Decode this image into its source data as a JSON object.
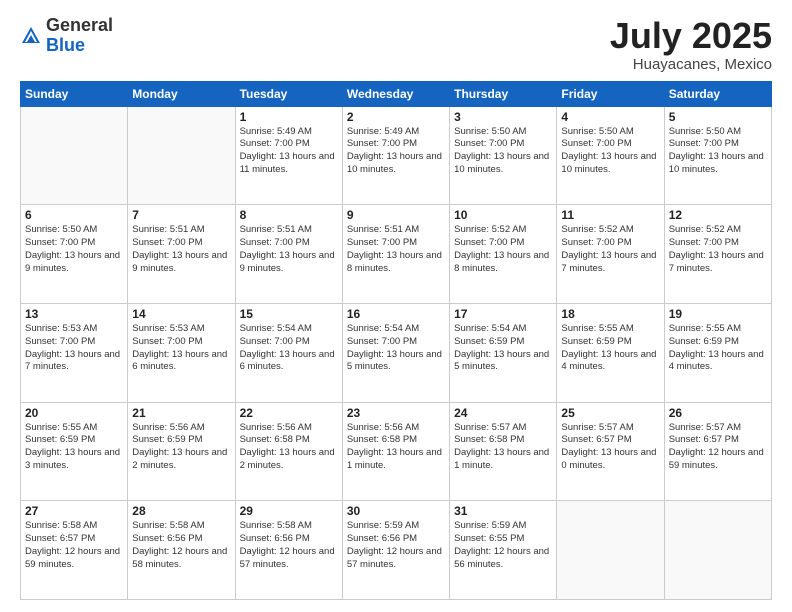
{
  "header": {
    "logo_general": "General",
    "logo_blue": "Blue",
    "month_title": "July 2025",
    "location": "Huayacanes, Mexico"
  },
  "weekdays": [
    "Sunday",
    "Monday",
    "Tuesday",
    "Wednesday",
    "Thursday",
    "Friday",
    "Saturday"
  ],
  "weeks": [
    [
      {
        "day": "",
        "info": ""
      },
      {
        "day": "",
        "info": ""
      },
      {
        "day": "1",
        "info": "Sunrise: 5:49 AM\nSunset: 7:00 PM\nDaylight: 13 hours and 11 minutes."
      },
      {
        "day": "2",
        "info": "Sunrise: 5:49 AM\nSunset: 7:00 PM\nDaylight: 13 hours and 10 minutes."
      },
      {
        "day": "3",
        "info": "Sunrise: 5:50 AM\nSunset: 7:00 PM\nDaylight: 13 hours and 10 minutes."
      },
      {
        "day": "4",
        "info": "Sunrise: 5:50 AM\nSunset: 7:00 PM\nDaylight: 13 hours and 10 minutes."
      },
      {
        "day": "5",
        "info": "Sunrise: 5:50 AM\nSunset: 7:00 PM\nDaylight: 13 hours and 10 minutes."
      }
    ],
    [
      {
        "day": "6",
        "info": "Sunrise: 5:50 AM\nSunset: 7:00 PM\nDaylight: 13 hours and 9 minutes."
      },
      {
        "day": "7",
        "info": "Sunrise: 5:51 AM\nSunset: 7:00 PM\nDaylight: 13 hours and 9 minutes."
      },
      {
        "day": "8",
        "info": "Sunrise: 5:51 AM\nSunset: 7:00 PM\nDaylight: 13 hours and 9 minutes."
      },
      {
        "day": "9",
        "info": "Sunrise: 5:51 AM\nSunset: 7:00 PM\nDaylight: 13 hours and 8 minutes."
      },
      {
        "day": "10",
        "info": "Sunrise: 5:52 AM\nSunset: 7:00 PM\nDaylight: 13 hours and 8 minutes."
      },
      {
        "day": "11",
        "info": "Sunrise: 5:52 AM\nSunset: 7:00 PM\nDaylight: 13 hours and 7 minutes."
      },
      {
        "day": "12",
        "info": "Sunrise: 5:52 AM\nSunset: 7:00 PM\nDaylight: 13 hours and 7 minutes."
      }
    ],
    [
      {
        "day": "13",
        "info": "Sunrise: 5:53 AM\nSunset: 7:00 PM\nDaylight: 13 hours and 7 minutes."
      },
      {
        "day": "14",
        "info": "Sunrise: 5:53 AM\nSunset: 7:00 PM\nDaylight: 13 hours and 6 minutes."
      },
      {
        "day": "15",
        "info": "Sunrise: 5:54 AM\nSunset: 7:00 PM\nDaylight: 13 hours and 6 minutes."
      },
      {
        "day": "16",
        "info": "Sunrise: 5:54 AM\nSunset: 7:00 PM\nDaylight: 13 hours and 5 minutes."
      },
      {
        "day": "17",
        "info": "Sunrise: 5:54 AM\nSunset: 6:59 PM\nDaylight: 13 hours and 5 minutes."
      },
      {
        "day": "18",
        "info": "Sunrise: 5:55 AM\nSunset: 6:59 PM\nDaylight: 13 hours and 4 minutes."
      },
      {
        "day": "19",
        "info": "Sunrise: 5:55 AM\nSunset: 6:59 PM\nDaylight: 13 hours and 4 minutes."
      }
    ],
    [
      {
        "day": "20",
        "info": "Sunrise: 5:55 AM\nSunset: 6:59 PM\nDaylight: 13 hours and 3 minutes."
      },
      {
        "day": "21",
        "info": "Sunrise: 5:56 AM\nSunset: 6:59 PM\nDaylight: 13 hours and 2 minutes."
      },
      {
        "day": "22",
        "info": "Sunrise: 5:56 AM\nSunset: 6:58 PM\nDaylight: 13 hours and 2 minutes."
      },
      {
        "day": "23",
        "info": "Sunrise: 5:56 AM\nSunset: 6:58 PM\nDaylight: 13 hours and 1 minute."
      },
      {
        "day": "24",
        "info": "Sunrise: 5:57 AM\nSunset: 6:58 PM\nDaylight: 13 hours and 1 minute."
      },
      {
        "day": "25",
        "info": "Sunrise: 5:57 AM\nSunset: 6:57 PM\nDaylight: 13 hours and 0 minutes."
      },
      {
        "day": "26",
        "info": "Sunrise: 5:57 AM\nSunset: 6:57 PM\nDaylight: 12 hours and 59 minutes."
      }
    ],
    [
      {
        "day": "27",
        "info": "Sunrise: 5:58 AM\nSunset: 6:57 PM\nDaylight: 12 hours and 59 minutes."
      },
      {
        "day": "28",
        "info": "Sunrise: 5:58 AM\nSunset: 6:56 PM\nDaylight: 12 hours and 58 minutes."
      },
      {
        "day": "29",
        "info": "Sunrise: 5:58 AM\nSunset: 6:56 PM\nDaylight: 12 hours and 57 minutes."
      },
      {
        "day": "30",
        "info": "Sunrise: 5:59 AM\nSunset: 6:56 PM\nDaylight: 12 hours and 57 minutes."
      },
      {
        "day": "31",
        "info": "Sunrise: 5:59 AM\nSunset: 6:55 PM\nDaylight: 12 hours and 56 minutes."
      },
      {
        "day": "",
        "info": ""
      },
      {
        "day": "",
        "info": ""
      }
    ]
  ]
}
